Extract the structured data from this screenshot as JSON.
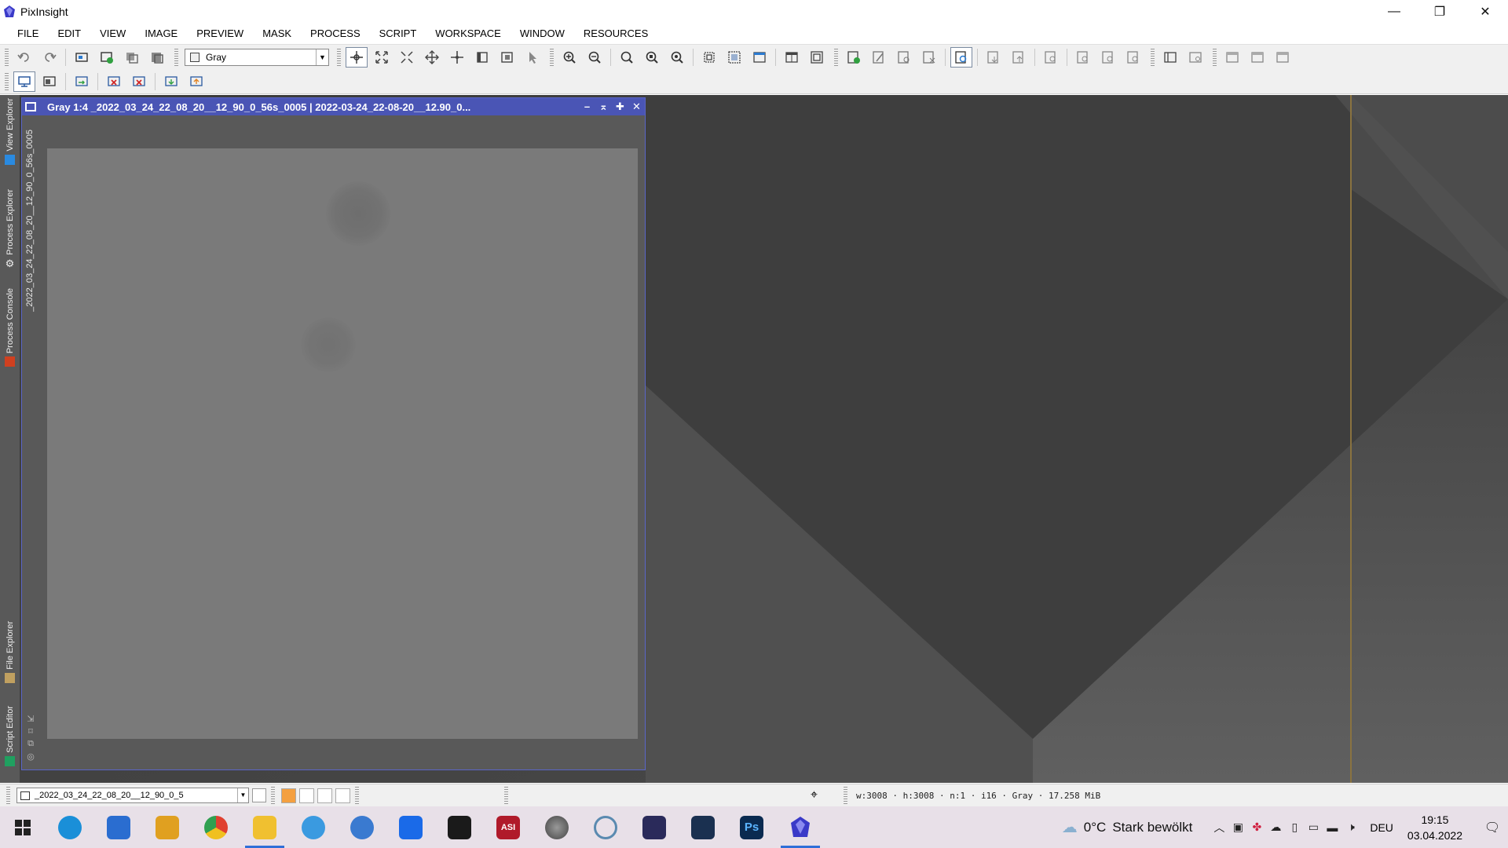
{
  "app": {
    "title": "PixInsight"
  },
  "window_controls": {
    "minimize": "—",
    "restore": "❐",
    "close": "✕"
  },
  "menu": [
    "FILE",
    "EDIT",
    "VIEW",
    "IMAGE",
    "PREVIEW",
    "MASK",
    "PROCESS",
    "SCRIPT",
    "WORKSPACE",
    "WINDOW",
    "RESOURCES"
  ],
  "toolbar": {
    "color_space_select": "Gray"
  },
  "left_dock": {
    "tabs": [
      "View Explorer",
      "Process Explorer",
      "Process Console",
      "File Explorer",
      "Script Editor"
    ]
  },
  "image_window": {
    "title": "Gray 1:4 _2022_03_24_22_08_20__12_90_0_56s_0005 | 2022-03-24_22-08-20__12.90_0...",
    "side_label": "_2022_03_24_22_08_20__12_90_0_56s_0005",
    "controls": [
      "–",
      "⌅",
      "✚",
      "✕"
    ]
  },
  "statusbar": {
    "view_select": "_2022_03_24_22_08_20__12_90_0_5",
    "info": "w:3008 · h:3008 · n:1 · i16 · Gray · 17.258 MiB",
    "swatch_colors": [
      "#f4a040",
      "#ffffff",
      "#ffffff",
      "#ffffff"
    ]
  },
  "taskbar": {
    "weather": {
      "temp": "0°C",
      "desc": "Stark bewölkt"
    },
    "language": "DEU",
    "time": "19:15",
    "date": "03.04.2022",
    "apps": [
      {
        "name": "edge",
        "color": "#1a8fd8"
      },
      {
        "name": "store",
        "color": "#2a6dd0"
      },
      {
        "name": "app-yellow",
        "color": "#e0a020"
      },
      {
        "name": "chrome",
        "color": "#e04030"
      },
      {
        "name": "file-explorer",
        "color": "#f0c030"
      },
      {
        "name": "internet-explorer",
        "color": "#3a9ae0"
      },
      {
        "name": "app-globe",
        "color": "#3a7ad0"
      },
      {
        "name": "dropbox",
        "color": "#1a6ae8"
      },
      {
        "name": "app-red",
        "color": "#1a1a1a"
      },
      {
        "name": "asi",
        "color": "#b01a2a"
      },
      {
        "name": "app-planet",
        "color": "#666666"
      },
      {
        "name": "app-ring",
        "color": "#5a8ab0"
      },
      {
        "name": "app-galaxy",
        "color": "#2a2a5a"
      },
      {
        "name": "app-stars",
        "color": "#1a3050"
      },
      {
        "name": "photoshop",
        "color": "#0a2a50"
      },
      {
        "name": "pixinsight",
        "color": "#3a3ac8"
      }
    ],
    "asi_label": "ASI",
    "ps_label": "Ps"
  }
}
